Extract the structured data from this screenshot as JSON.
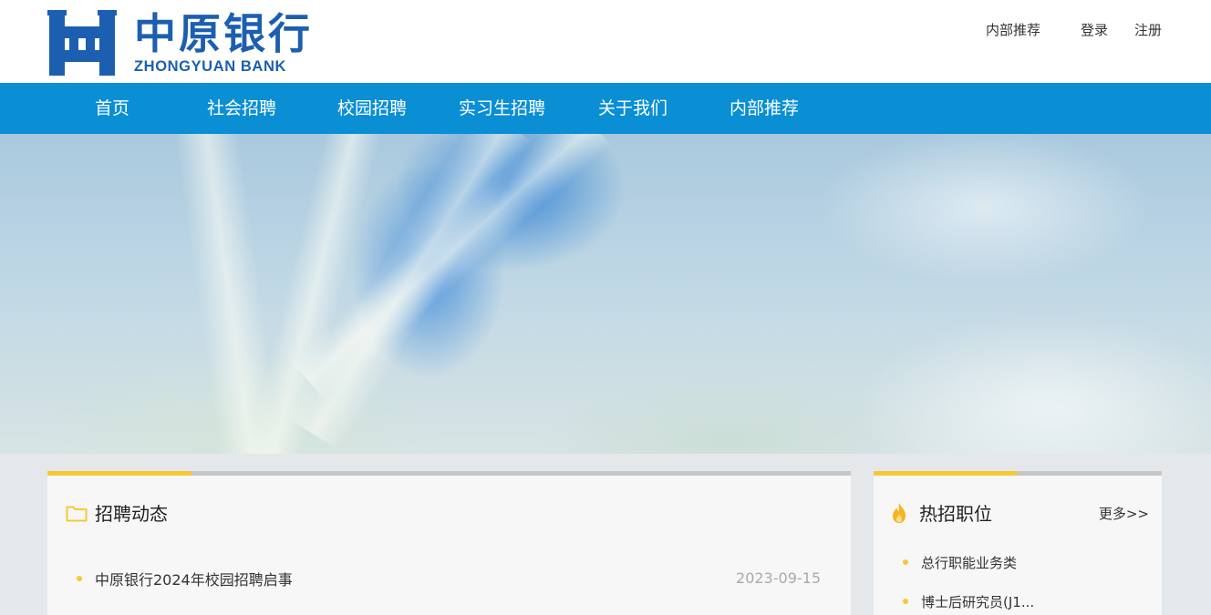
{
  "header": {
    "logo_cn": "中原银行",
    "logo_en": "ZHONGYUAN BANK",
    "logo_color": "#1c5fb0",
    "links": {
      "referral": "内部推荐",
      "login": "登录",
      "register": "注册"
    }
  },
  "nav": {
    "background": "#0a8fd4",
    "items": [
      "首页",
      "社会招聘",
      "校园招聘",
      "实习生招聘",
      "关于我们",
      "内部推荐"
    ]
  },
  "news": {
    "title": "招聘动态",
    "accent_color": "#f5c936",
    "items": [
      {
        "text": "中原银行2024年校园招聘启事",
        "date": "2023-09-15"
      }
    ]
  },
  "hot_jobs": {
    "title": "热招职位",
    "more": "更多>>",
    "items": [
      "总行职能业务类",
      "博士后研究员(J1..."
    ]
  }
}
